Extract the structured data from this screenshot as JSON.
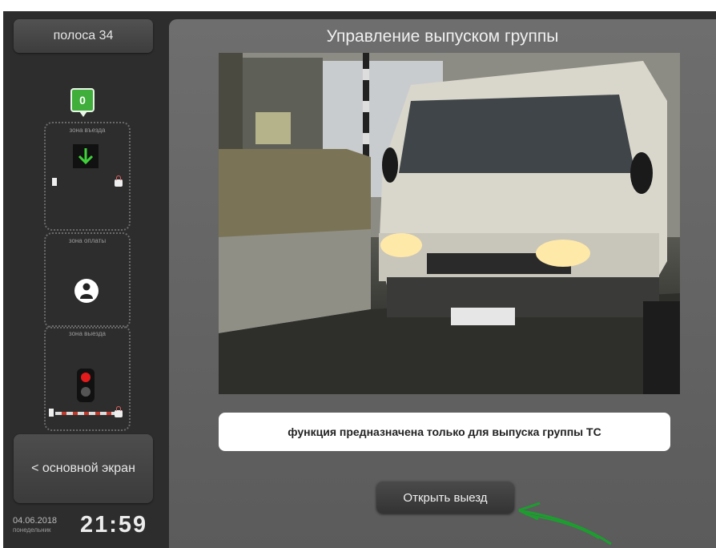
{
  "sidebar": {
    "lane_label": "полоса 34",
    "counter": "0",
    "zones": [
      {
        "label": "зона въезда"
      },
      {
        "label": "зона оплаты"
      },
      {
        "label": "зона выезда"
      }
    ],
    "main_screen_label": "< основной экран",
    "date": "04.06.2018",
    "weekday": "понедельник",
    "time": "21:59"
  },
  "panel": {
    "title": "Управление выпуском группы",
    "info_text": "функция предназначена только для выпуска группы ТС",
    "open_exit_label": "Открыть выезд"
  },
  "colors": {
    "sidebar_bg": "#2d2d2d",
    "panel_bg": "#666666",
    "counter_green": "#3fae3a",
    "traffic_red": "#e31b1b",
    "annotation_arrow": "#1c9e2f"
  }
}
